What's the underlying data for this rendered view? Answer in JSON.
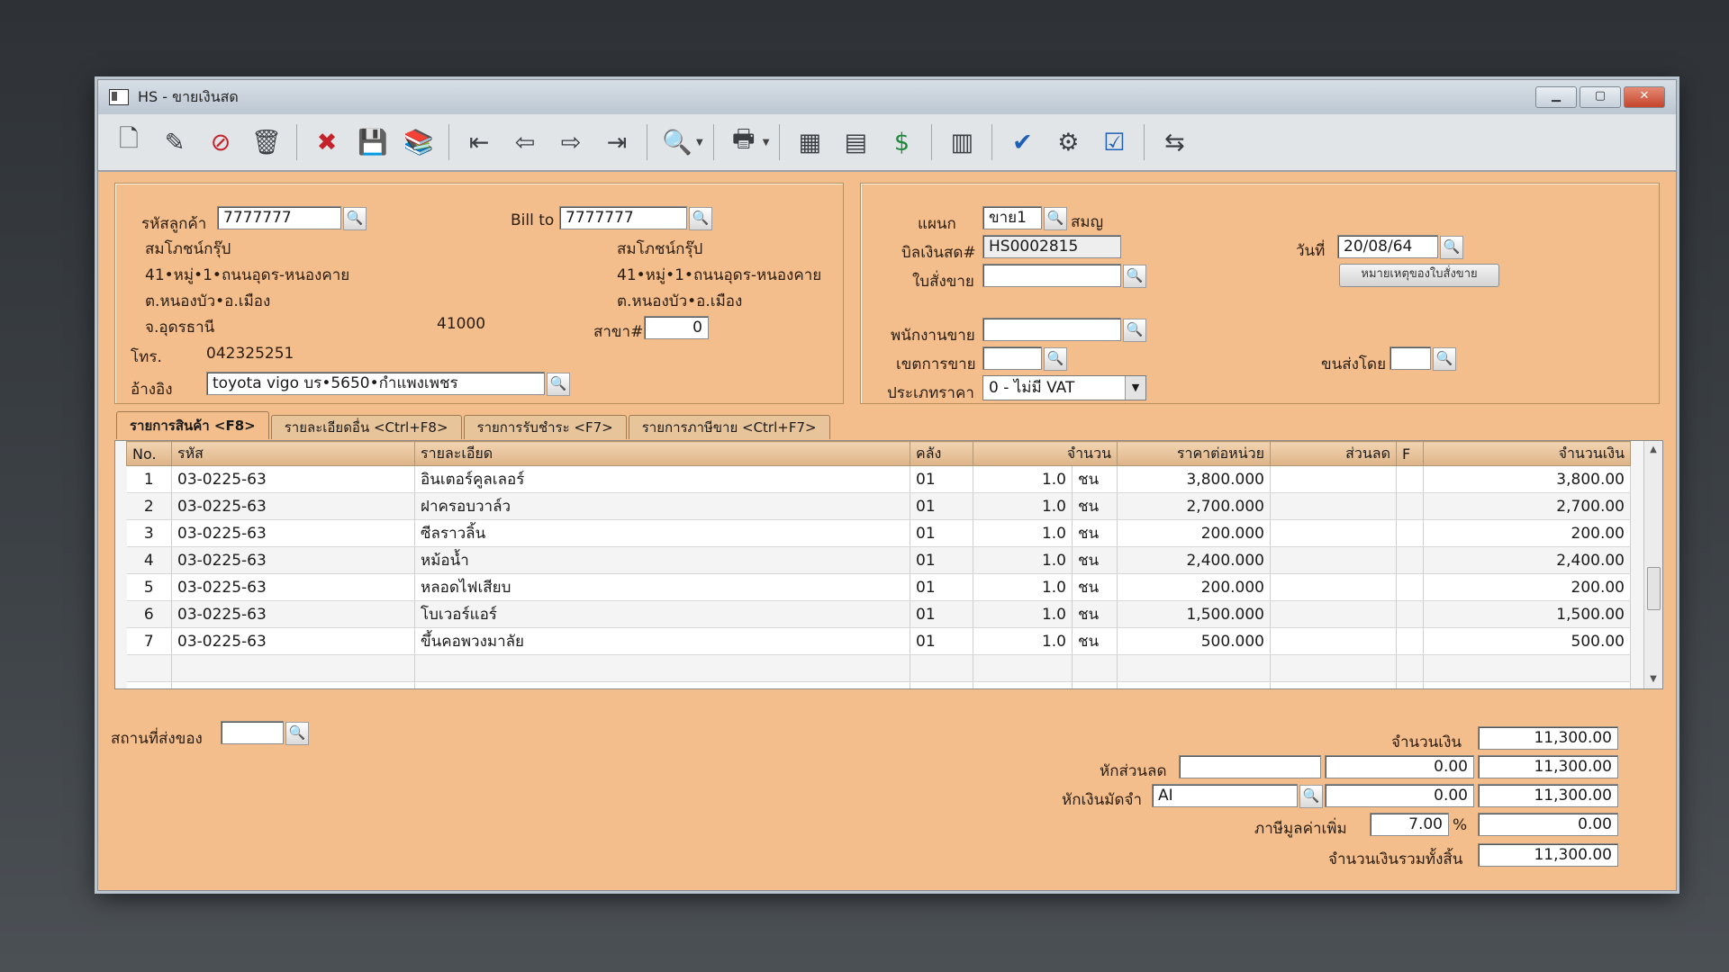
{
  "window": {
    "title": "HS - ขายเงินสด",
    "minimize": "▁",
    "maximize": "▢",
    "close": "✕"
  },
  "toolbar": {
    "items": [
      {
        "name": "new-document-icon",
        "glyph": "🗋"
      },
      {
        "name": "edit-icon",
        "glyph": "✎"
      },
      {
        "name": "void-icon",
        "glyph": "⊘"
      },
      {
        "name": "trash-icon",
        "glyph": "🗑"
      },
      {
        "name": "cancel-icon",
        "glyph": "✖"
      },
      {
        "name": "save-icon",
        "glyph": "💾"
      },
      {
        "name": "books-icon",
        "glyph": "📚"
      },
      {
        "name": "first-record-icon",
        "glyph": "⇤"
      },
      {
        "name": "previous-record-icon",
        "glyph": "⇦"
      },
      {
        "name": "next-record-icon",
        "glyph": "⇨"
      },
      {
        "name": "last-record-icon",
        "glyph": "⇥"
      },
      {
        "name": "search-doc-icon",
        "glyph": "🔍"
      },
      {
        "name": "printer-icon",
        "glyph": "🖶"
      },
      {
        "name": "calculator-icon",
        "glyph": "▦"
      },
      {
        "name": "form-icon",
        "glyph": "▤"
      },
      {
        "name": "money-icon",
        "glyph": "$"
      },
      {
        "name": "calendar-icon",
        "glyph": "▥"
      },
      {
        "name": "ok-user-icon",
        "glyph": "✔"
      },
      {
        "name": "tools-icon",
        "glyph": "⚙"
      },
      {
        "name": "ok-box-icon",
        "glyph": "☑"
      },
      {
        "name": "transfer-icon",
        "glyph": "⇆"
      }
    ]
  },
  "customer": {
    "code_label": "รหัสลูกค้า",
    "code_value": "7777777",
    "name": "สมโภชน์กรุ๊ป",
    "addr1": "41•หมู่•1•ถนนอุดร-หนองคาย",
    "addr2": "ต.หนองบัว•อ.เมือง",
    "addr3": "จ.อุดรธานี",
    "postcode": "41000",
    "phone_label": "โทร.",
    "phone": "042325251",
    "ref_label": "อ้างอิง",
    "ref_value": "toyota vigo บร•5650•กำแพงเพชร"
  },
  "billto": {
    "label": "Bill to",
    "value": "7777777",
    "name": "สมโภชน์กรุ๊ป",
    "addr1": "41•หมู่•1•ถนนอุดร-หนองคาย",
    "addr2": "ต.หนองบัว•อ.เมือง",
    "branch_label": "สาขา#",
    "branch_value": "0"
  },
  "header": {
    "dept_label": "แผนก",
    "dept_value": "ขาย1",
    "dept_name": "สมญ",
    "bill_label": "บิลเงินสด#",
    "bill_value": "HS0002815",
    "date_label": "วันที่",
    "date_value": "20/08/64",
    "order_label": "ใบสั่งขาย",
    "order_note_button": "หมายเหตุของใบสั่งขาย",
    "salesman_label": "พนักงานขาย",
    "zone_label": "เขตการขาย",
    "shipby_label": "ขนส่งโดย",
    "price_type_label": "ประเภทราคา",
    "price_type_value": "0 - ไม่มี VAT"
  },
  "tabs": [
    "รายการสินค้า <F8>",
    "รายละเอียดอื่น <Ctrl+F8>",
    "รายการรับชำระ <F7>",
    "รายการภาษีขาย <Ctrl+F7>"
  ],
  "grid": {
    "columns": [
      "No.",
      "รหัส",
      "รายละเอียด",
      "คลัง",
      "จำนวน",
      "ราคาต่อหน่วย",
      "ส่วนลด",
      "F",
      "จำนวนเงิน"
    ],
    "rows": [
      {
        "no": "1",
        "code": "03-0225-63",
        "desc": "อินเตอร์คูลเลอร์",
        "wh": "01",
        "qty": "1.0",
        "unit": "ชน",
        "price": "3,800.000",
        "disc": "",
        "f": "",
        "amount": "3,800.00"
      },
      {
        "no": "2",
        "code": "03-0225-63",
        "desc": "ฝาครอบวาล์ว",
        "wh": "01",
        "qty": "1.0",
        "unit": "ชน",
        "price": "2,700.000",
        "disc": "",
        "f": "",
        "amount": "2,700.00"
      },
      {
        "no": "3",
        "code": "03-0225-63",
        "desc": "ซีลราวลิ้น",
        "wh": "01",
        "qty": "1.0",
        "unit": "ชน",
        "price": "200.000",
        "disc": "",
        "f": "",
        "amount": "200.00"
      },
      {
        "no": "4",
        "code": "03-0225-63",
        "desc": "หม้อน้ำ",
        "wh": "01",
        "qty": "1.0",
        "unit": "ชน",
        "price": "2,400.000",
        "disc": "",
        "f": "",
        "amount": "2,400.00"
      },
      {
        "no": "5",
        "code": "03-0225-63",
        "desc": "หลอดไฟเสียบ",
        "wh": "01",
        "qty": "1.0",
        "unit": "ชน",
        "price": "200.000",
        "disc": "",
        "f": "",
        "amount": "200.00"
      },
      {
        "no": "6",
        "code": "03-0225-63",
        "desc": "โบเวอร์แอร์",
        "wh": "01",
        "qty": "1.0",
        "unit": "ชน",
        "price": "1,500.000",
        "disc": "",
        "f": "",
        "amount": "1,500.00"
      },
      {
        "no": "7",
        "code": "03-0225-63",
        "desc": "ขึ้นคอพวงมาลัย",
        "wh": "01",
        "qty": "1.0",
        "unit": "ชน",
        "price": "500.000",
        "disc": "",
        "f": "",
        "amount": "500.00"
      }
    ]
  },
  "footer": {
    "ship_place_label": "สถานที่ส่งของ",
    "amount_label": "จำนวนเงิน",
    "amount_value": "11,300.00",
    "discount_label": "หักส่วนลด",
    "discount_value": "0.00",
    "after_discount": "11,300.00",
    "deposit_label": "หักเงินมัดจำ",
    "deposit_code": "AI",
    "deposit_value": "0.00",
    "after_deposit": "11,300.00",
    "vat_label": "ภาษีมูลค่าเพิ่ม",
    "vat_rate": "7.00",
    "vat_percent_sign": "%",
    "vat_value": "0.00",
    "total_label": "จำนวนเงินรวมทั้งสิ้น",
    "total_value": "11,300.00"
  }
}
